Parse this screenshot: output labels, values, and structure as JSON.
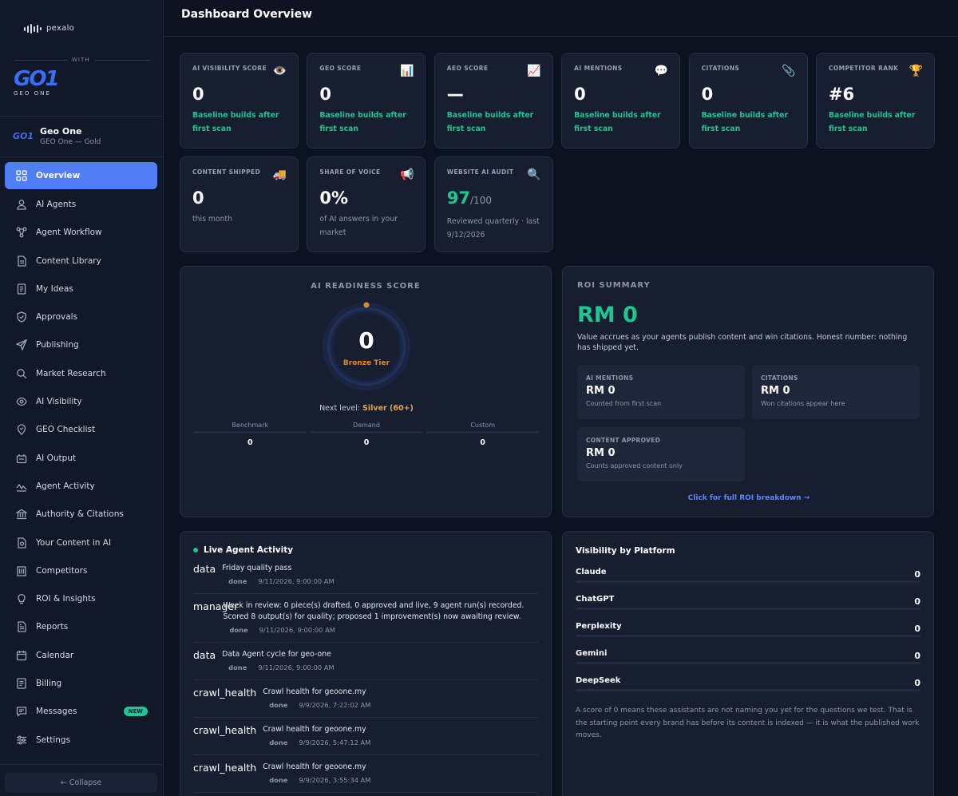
{
  "brand": {
    "name": "pexalo",
    "with": "WITH",
    "partner_logo": "GO1",
    "partner_sub": "GEO ONE"
  },
  "account": {
    "mini": "GO1",
    "name": "Geo One",
    "tier": "GEO One — Gold"
  },
  "nav": [
    {
      "label": "Overview",
      "icon": "grid-icon",
      "active": true
    },
    {
      "label": "AI Agents",
      "icon": "user-icon"
    },
    {
      "label": "Agent Workflow",
      "icon": "workflow-icon"
    },
    {
      "label": "Content Library",
      "icon": "document-icon"
    },
    {
      "label": "My Ideas",
      "icon": "notes-icon"
    },
    {
      "label": "Approvals",
      "icon": "shield-icon"
    },
    {
      "label": "Publishing",
      "icon": "send-icon"
    },
    {
      "label": "Market Research",
      "icon": "search-icon"
    },
    {
      "label": "AI Visibility",
      "icon": "eye-icon"
    },
    {
      "label": "GEO Checklist",
      "icon": "pin-icon"
    },
    {
      "label": "AI Output",
      "icon": "output-icon"
    },
    {
      "label": "Agent Activity",
      "icon": "activity-icon"
    },
    {
      "label": "Authority & Citations",
      "icon": "bank-icon"
    },
    {
      "label": "Your Content in AI",
      "icon": "content-ai-icon"
    },
    {
      "label": "Competitors",
      "icon": "building-icon"
    },
    {
      "label": "ROI & Insights",
      "icon": "bulb-icon"
    },
    {
      "label": "Reports",
      "icon": "report-icon"
    },
    {
      "label": "Calendar",
      "icon": "calendar-icon"
    },
    {
      "label": "Billing",
      "icon": "billing-icon"
    },
    {
      "label": "Messages",
      "icon": "message-icon",
      "badge": "NEW"
    },
    {
      "label": "Settings",
      "icon": "sliders-icon"
    }
  ],
  "collapse_label": "← Collapse",
  "page_title": "Dashboard Overview",
  "stats": [
    {
      "label": "AI VISIBILITY SCORE",
      "emoji": "👁️",
      "value": "0",
      "note": "Baseline builds after first scan"
    },
    {
      "label": "GEO SCORE",
      "emoji": "📊",
      "value": "0",
      "note": "Baseline builds after first scan"
    },
    {
      "label": "AEO SCORE",
      "emoji": "📈",
      "value": "—",
      "note": "Baseline builds after first scan"
    },
    {
      "label": "AI MENTIONS",
      "emoji": "💬",
      "value": "0",
      "note": "Baseline builds after first scan"
    },
    {
      "label": "CITATIONS",
      "emoji": "📎",
      "value": "0",
      "note": "Baseline builds after first scan"
    },
    {
      "label": "COMPETITOR RANK",
      "emoji": "🏆",
      "value": "#6",
      "note": "Baseline builds after first scan"
    },
    {
      "label": "CONTENT SHIPPED",
      "emoji": "🚚",
      "value": "0",
      "note": "this month"
    },
    {
      "label": "SHARE OF VOICE",
      "emoji": "📢",
      "value": "0%",
      "note": "of AI answers in your market"
    },
    {
      "label": "WEBSITE AI AUDIT",
      "emoji": "🔍",
      "value": "97",
      "unit": "/100",
      "note": "Reviewed quarterly · last 9/12/2026"
    }
  ],
  "readiness": {
    "title": "AI READINESS SCORE",
    "score": "0",
    "tier": "Bronze Tier",
    "next_prefix": "Next level: ",
    "next_level": "Silver (60+)",
    "mini": [
      {
        "label": "Benchmark",
        "value": "0"
      },
      {
        "label": "Demand",
        "value": "0"
      },
      {
        "label": "Custom",
        "value": "0"
      }
    ]
  },
  "roi": {
    "title": "ROI SUMMARY",
    "value": "RM 0",
    "desc": "Value accrues as your agents publish content and win citations. Honest number: nothing has shipped yet.",
    "cards": [
      {
        "label": "AI MENTIONS",
        "value": "RM 0",
        "note": "Counted from first scan"
      },
      {
        "label": "CITATIONS",
        "value": "RM 0",
        "note": "Won citations appear here"
      },
      {
        "label": "CONTENT APPROVED",
        "value": "RM 0",
        "note": "Counts approved content only"
      }
    ],
    "link": "Click for full ROI breakdown →"
  },
  "activity": {
    "title": "Live Agent Activity",
    "items": [
      {
        "agent": "data",
        "text": "Friday quality pass",
        "status": "done",
        "time": "9/11/2026, 9:00:00 AM"
      },
      {
        "agent": "manager",
        "text": "Week in review: 0 piece(s) drafted, 0 approved and live, 9 agent run(s) recorded. Scored 8 output(s) for quality; proposed 1 improvement(s) now awaiting review.",
        "status": "done",
        "time": "9/11/2026, 9:00:00 AM"
      },
      {
        "agent": "data",
        "text": "Data Agent cycle for geo-one",
        "status": "done",
        "time": "9/11/2026, 9:00:00 AM"
      },
      {
        "agent": "crawl_health",
        "text": "Crawl health for geoone.my",
        "status": "done",
        "time": "9/9/2026, 7:22:02 AM"
      },
      {
        "agent": "crawl_health",
        "text": "Crawl health for geoone.my",
        "status": "done",
        "time": "9/9/2026, 5:47:12 AM"
      },
      {
        "agent": "crawl_health",
        "text": "Crawl health for geoone.my",
        "status": "done",
        "time": "9/9/2026, 3:55:34 AM"
      }
    ]
  },
  "platforms": {
    "title": "Visibility by Platform",
    "items": [
      {
        "name": "Claude",
        "value": "0"
      },
      {
        "name": "ChatGPT",
        "value": "0"
      },
      {
        "name": "Perplexity",
        "value": "0"
      },
      {
        "name": "Gemini",
        "value": "0"
      },
      {
        "name": "DeepSeek",
        "value": "0"
      }
    ],
    "foot": "A score of 0 means these assistants are not naming you yet for the questions we test. That is the starting point every brand has before its content is indexed — it is what the published work moves."
  },
  "colors": {
    "accent": "#4f7ef7",
    "green": "#22c58f",
    "bronze": "#e08a2c",
    "bg": "#0d1220",
    "card": "#161e30"
  }
}
